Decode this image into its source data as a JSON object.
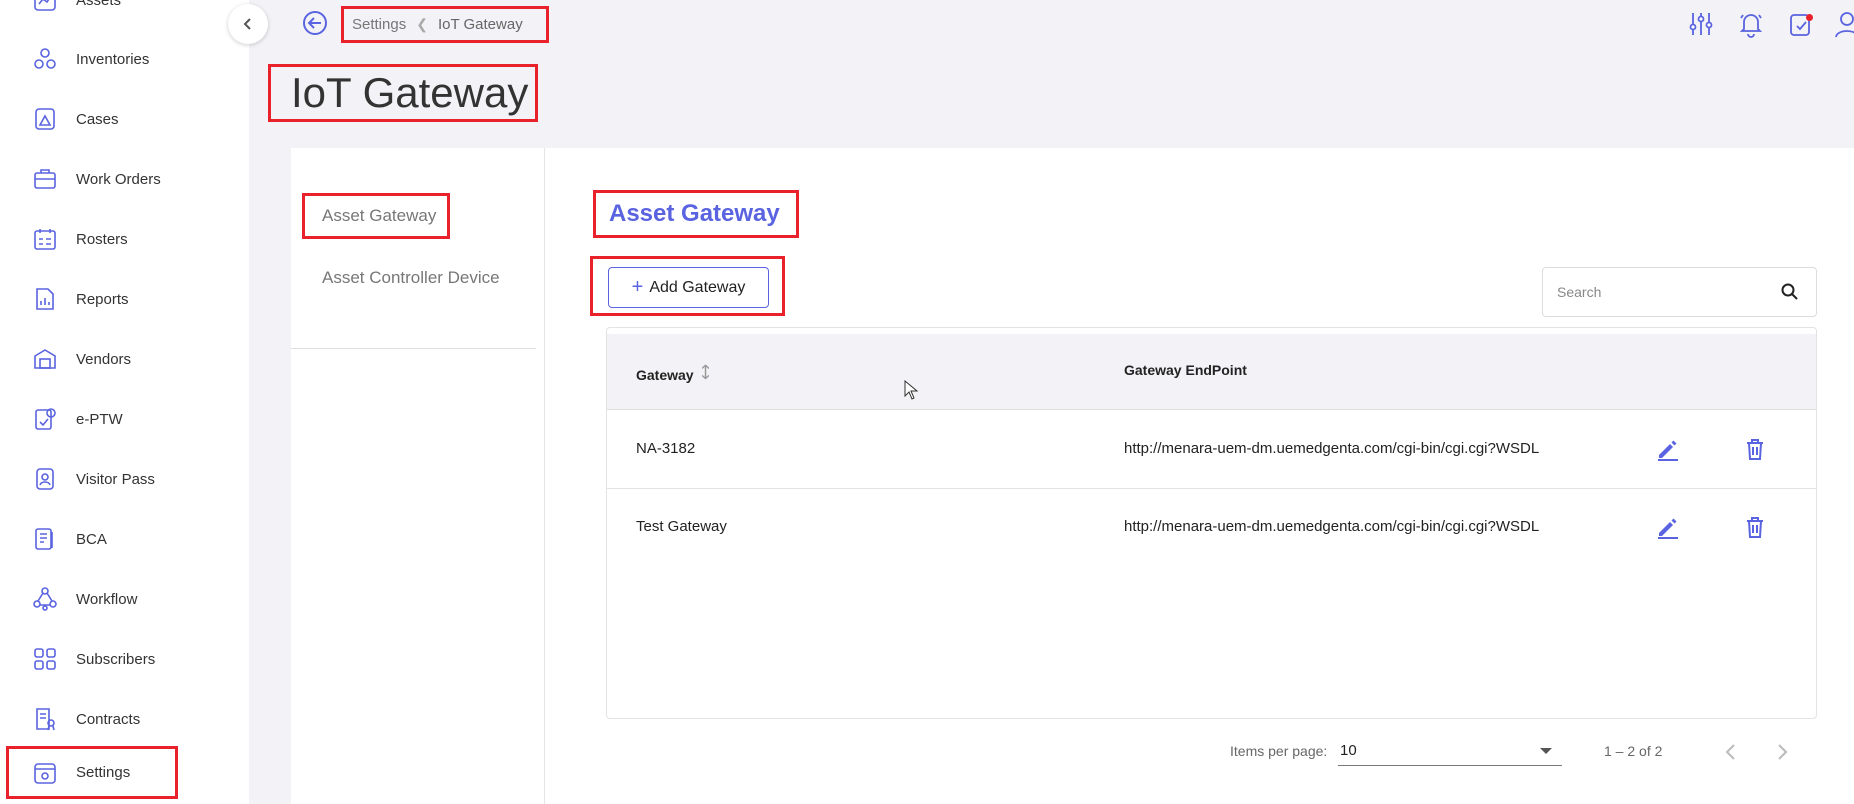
{
  "sidebar": {
    "items": [
      {
        "label": "Assets",
        "icon": "assets-icon"
      },
      {
        "label": "Inventories",
        "icon": "inventories-icon"
      },
      {
        "label": "Cases",
        "icon": "cases-icon"
      },
      {
        "label": "Work Orders",
        "icon": "work-orders-icon"
      },
      {
        "label": "Rosters",
        "icon": "rosters-icon"
      },
      {
        "label": "Reports",
        "icon": "reports-icon"
      },
      {
        "label": "Vendors",
        "icon": "vendors-icon"
      },
      {
        "label": "e-PTW",
        "icon": "eptw-icon"
      },
      {
        "label": "Visitor Pass",
        "icon": "visitor-pass-icon"
      },
      {
        "label": "BCA",
        "icon": "bca-icon"
      },
      {
        "label": "Workflow",
        "icon": "workflow-icon"
      },
      {
        "label": "Subscribers",
        "icon": "subscribers-icon"
      },
      {
        "label": "Contracts",
        "icon": "contracts-icon"
      },
      {
        "label": "Settings",
        "icon": "settings-icon",
        "selected": true
      }
    ]
  },
  "breadcrumb": {
    "parent": "Settings",
    "current": "IoT Gateway"
  },
  "page_title": "IoT Gateway",
  "left_nav": {
    "items": [
      "Asset Gateway",
      "Asset Controller Device"
    ]
  },
  "section": {
    "title": "Asset Gateway",
    "add_label": "Add Gateway"
  },
  "search": {
    "placeholder": "Search"
  },
  "table": {
    "columns": [
      "Gateway",
      "Gateway EndPoint"
    ],
    "rows": [
      {
        "gateway": "NA-3182",
        "endpoint": "http://menara-uem-dm.uemedgenta.com/cgi-bin/cgi.cgi?WSDL"
      },
      {
        "gateway": "Test Gateway",
        "endpoint": "http://menara-uem-dm.uemedgenta.com/cgi-bin/cgi.cgi?WSDL"
      }
    ]
  },
  "pagination": {
    "items_per_page_label": "Items per page:",
    "items_per_page": "10",
    "range": "1 – 2 of 2"
  },
  "colors": {
    "accent": "#5a63e0",
    "highlight": "#e8212a"
  }
}
